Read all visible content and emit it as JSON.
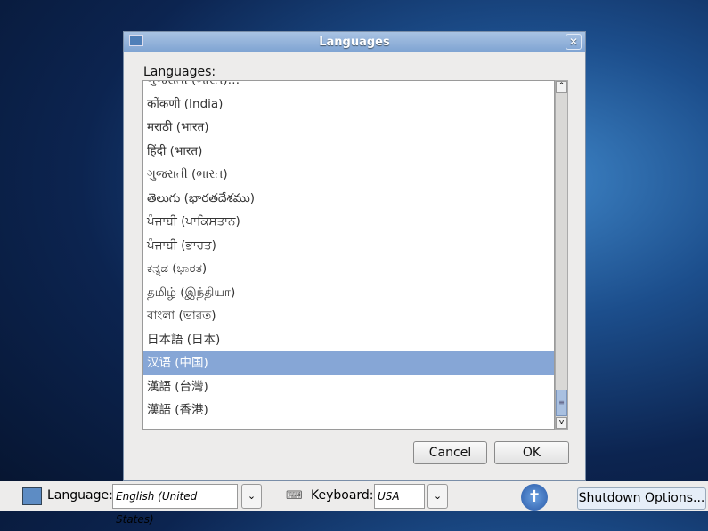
{
  "dialog": {
    "title": "Languages",
    "label": "Languages:",
    "items": [
      "ગુજરાતી (ભારત)…",
      "कोंकणी (India)",
      "मराठी (भारत)",
      "हिंदी (भारत)",
      "ગુજરાતી (ભારત)",
      "తెలుగు (భారతదేశము)",
      "ਪੰਜਾਬੀ (ਪਾਕਿਸਤਾਨ)",
      "ਪੰਜਾਬੀ (ਭਾਰਤ)",
      "ಕನ್ನಡ (ಭಾರತ)",
      "தமிழ் (இந்தியா)",
      "বাংলা (ভারত)",
      "日本語 (日本)",
      "汉语 (中国)",
      "漢語 (台灣)",
      "漢語 (香港)"
    ],
    "selected_index": 12,
    "cancel": "Cancel",
    "ok": "OK"
  },
  "bottom": {
    "language_label": "Language:",
    "language_value": "English (United States)",
    "keyboard_label": "Keyboard:",
    "keyboard_value": "USA",
    "shutdown": "Shutdown Options..."
  }
}
